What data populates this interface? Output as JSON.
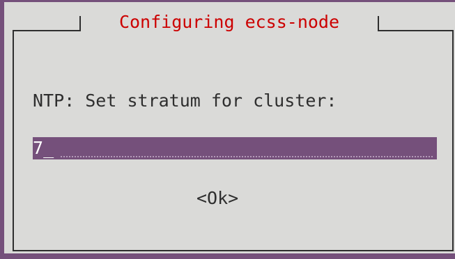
{
  "dialog": {
    "title": "Configuring ecss-node",
    "prompt": "NTP: Set stratum for cluster:",
    "input": {
      "value": "7",
      "cursor": "_"
    },
    "ok_label": "<Ok>"
  },
  "colors": {
    "background": "#dadad8",
    "title": "#cc0000",
    "input_fill": "#75507b",
    "text": "#2e2e2e",
    "terminal_edge": "#75507b"
  }
}
